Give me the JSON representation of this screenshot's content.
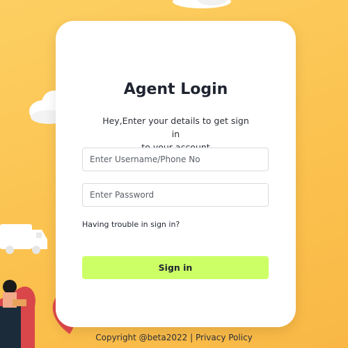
{
  "card": {
    "title": "Agent Login",
    "subtitle_line1": "Hey,Enter your details to get sign in",
    "subtitle_line2": "to your account"
  },
  "form": {
    "username_placeholder": "Enter Username/Phone No",
    "password_placeholder": "Enter Password",
    "trouble_text": "Having trouble in sign in?",
    "signin_label": "Sign in"
  },
  "footer": {
    "copyright": "Copyright @beta2022",
    "separator": "|",
    "privacy": "Privacy Policy"
  },
  "colors": {
    "background": "#fbc24f",
    "card": "#ffffff",
    "button": "#ccff66",
    "text": "#1f2430"
  }
}
